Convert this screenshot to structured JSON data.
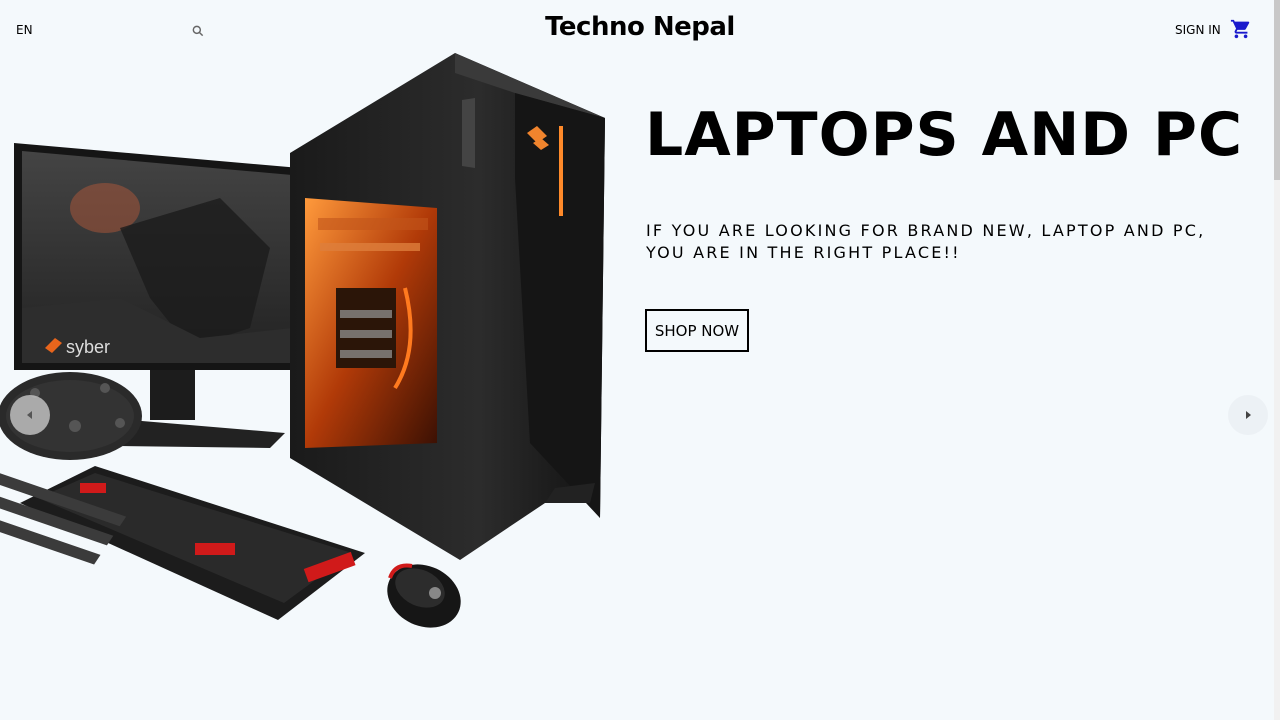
{
  "header": {
    "language": "EN",
    "brand": "Techno Nepal",
    "sign_in": "SIGN IN"
  },
  "hero": {
    "title": "LAPTOPS AND PC",
    "subtitle": "IF YOU ARE LOOKING FOR BRAND NEW, LAPTOP AND PC, YOU ARE IN THE RIGHT PLACE!!",
    "cta": "SHOP NOW",
    "monitor_brand": "syber"
  },
  "icons": {
    "search": "search-icon",
    "cart": "cart-icon",
    "prev": "chevron-left-icon",
    "next": "chevron-right-icon"
  },
  "colors": {
    "background": "#f4f9fc",
    "cart_icon": "#1a1acc",
    "text": "#000000"
  }
}
